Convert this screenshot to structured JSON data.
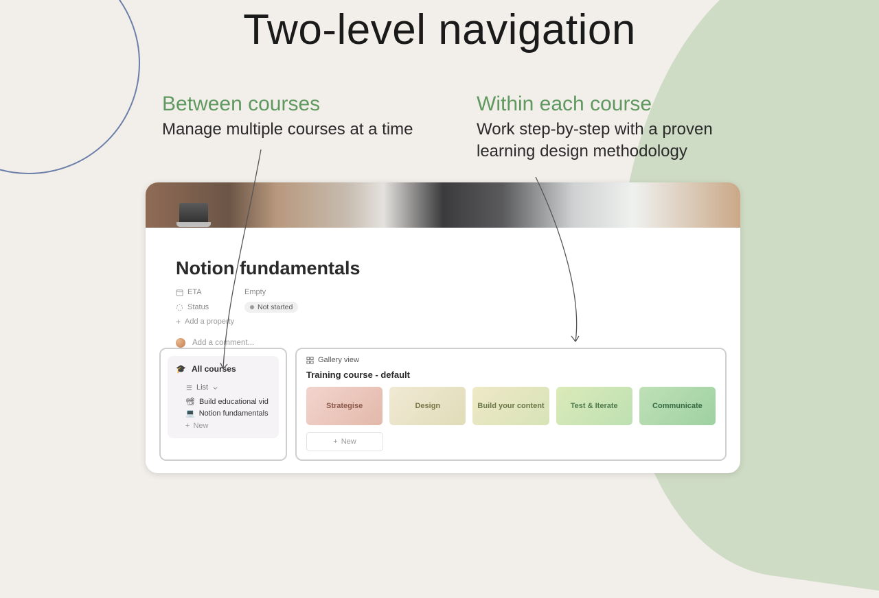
{
  "title": "Two-level navigation",
  "captions": {
    "left": {
      "eyebrow": "Between courses",
      "desc": "Manage multiple courses at a time"
    },
    "right": {
      "eyebrow": "Within each course",
      "desc": "Work step-by-step with a proven learning design methodology"
    }
  },
  "doc": {
    "title": "Notion fundamentals",
    "props": {
      "eta": {
        "label": "ETA",
        "value": "Empty"
      },
      "status": {
        "label": "Status",
        "value": "Not started"
      },
      "add_property": "Add a property"
    },
    "comment_placeholder": "Add a comment..."
  },
  "sidebar": {
    "all_courses": "All courses",
    "list_toggle": "List",
    "items": [
      {
        "icon": "📽",
        "label": "Build educational vid"
      },
      {
        "icon": "💻",
        "label": "Notion fundamentals"
      }
    ],
    "new": "New"
  },
  "main": {
    "view_label": "Gallery view",
    "section_title": "Training course - default",
    "cards": [
      "Strategise",
      "Design",
      "Build your content",
      "Test & Iterate",
      "Communicate"
    ],
    "new": "New"
  }
}
